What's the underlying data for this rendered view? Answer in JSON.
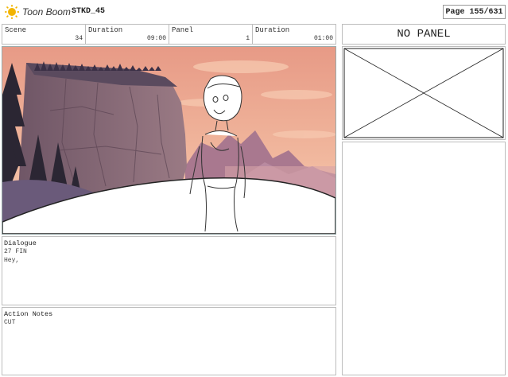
{
  "header": {
    "logo_text": "Toon Boom",
    "project_name": "STKD_45",
    "page_label": "Page 155/631"
  },
  "info": {
    "scene_label": "Scene",
    "scene_value": "34",
    "scene_duration_label": "Duration",
    "scene_duration_value": "09:00",
    "panel_label": "Panel",
    "panel_value": "1",
    "panel_duration_label": "Duration",
    "panel_duration_value": "01:00"
  },
  "side": {
    "no_panel_label": "NO PANEL"
  },
  "dialogue": {
    "label": "Dialogue",
    "lines": [
      "27 FIN",
      "Hey,"
    ]
  },
  "action_notes": {
    "label": "Action Notes",
    "lines": [
      "CUT"
    ]
  },
  "colors": {
    "accent_logo": "#f2b400",
    "frame_sky_top": "#e9a08a",
    "frame_sky_bottom": "#f3c3a8",
    "cliff": "#8b6c78",
    "trees": "#2e2a3a",
    "far_mountains": "#a4768e"
  }
}
